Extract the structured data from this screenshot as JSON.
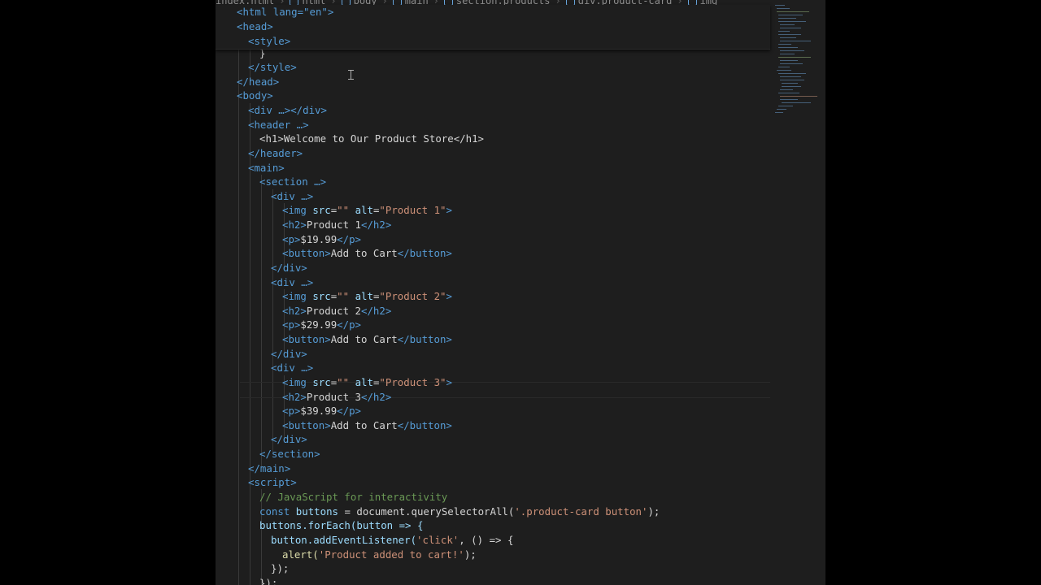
{
  "breadcrumb": {
    "items": [
      "index.html",
      "html",
      "body",
      "main",
      "section.products",
      "div.product-card",
      "img"
    ]
  },
  "code": {
    "sticky_lines": [
      "<html lang=\"en\">",
      "<head>",
      "<style>"
    ],
    "style_close_brace": "}",
    "style_close": "</style>",
    "head_close": "</head>",
    "body_open": "<body>",
    "div_collapsed": "<div …></div>",
    "header_collapsed": "<header …>",
    "h1_line": "<h1>Welcome to Our Product Store</h1>",
    "header_close": "</header>",
    "main_open": "<main>",
    "section_collapsed": "<section …>",
    "products": [
      {
        "div_open": "<div …>",
        "img_alt": "Product 1",
        "name": "Product 1",
        "price": "$19.99",
        "button_label": "Add to Cart"
      },
      {
        "div_open": "<div …>",
        "img_alt": "Product 2",
        "name": "Product 2",
        "price": "$29.99",
        "button_label": "Add to Cart"
      },
      {
        "div_open": "<div …>",
        "img_alt": "Product 3",
        "name": "Product 3",
        "price": "$39.99",
        "button_label": "Add to Cart"
      }
    ],
    "section_close": "</section>",
    "main_close": "</main>",
    "script_open": "<script>",
    "comment": "// JavaScript for interactivity",
    "js_line1_kw": "const",
    "js_line1_var": "buttons",
    "js_line1_rest": " = document.querySelectorAll(",
    "js_line1_str": "'.product-card button'",
    "js_line2": "buttons.forEach(button => {",
    "js_line3": "button.addEventListener(",
    "js_line3_str": "'click'",
    "js_line3_rest": ", () => {",
    "js_line4": "alert(",
    "js_line4_str": "'Product added to cart!'",
    "js_line5": "});",
    "js_line6": "});"
  },
  "theme": {
    "background": "#1e1e1e",
    "tag_color": "#569cd6",
    "attr_color": "#9cdcfe",
    "string_color": "#ce9178",
    "comment_color": "#6a9955"
  }
}
